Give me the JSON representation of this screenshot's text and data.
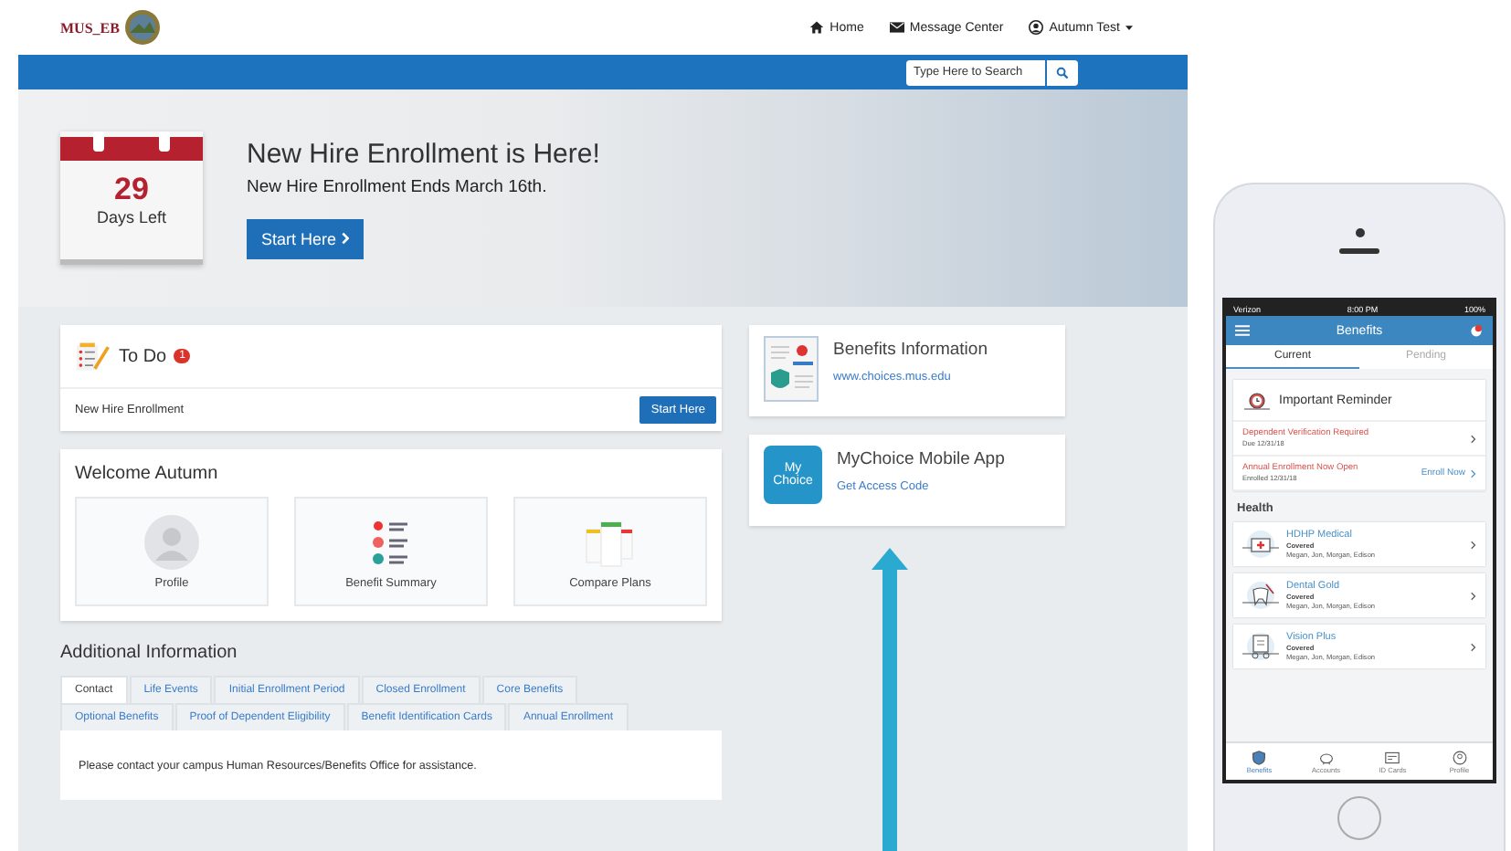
{
  "header": {
    "logo_text": "MUS_EB",
    "nav": [
      {
        "kind": "home",
        "label": "Home"
      },
      {
        "kind": "mail",
        "label": "Message Center"
      },
      {
        "kind": "user",
        "label": "Autumn Test"
      }
    ]
  },
  "search": {
    "placeholder": "Type Here to Search"
  },
  "hero": {
    "days": "29",
    "days_label": "Days Left",
    "title": "New Hire Enrollment is Here!",
    "subtitle": "New Hire Enrollment Ends March 16th.",
    "button": "Start Here"
  },
  "todo": {
    "title": "To Do",
    "count": "1",
    "item": "New Hire Enrollment",
    "button": "Start Here"
  },
  "welcome": {
    "title": "Welcome Autumn",
    "tiles": [
      {
        "kind": "profile",
        "label": "Profile"
      },
      {
        "kind": "summary",
        "label": "Benefit Summary"
      },
      {
        "kind": "compare",
        "label": "Compare Plans"
      }
    ]
  },
  "additional": {
    "title": "Additional Information",
    "tab_rows": [
      [
        {
          "label": "Contact",
          "selected": true
        },
        {
          "label": "Life Events",
          "selected": false
        },
        {
          "label": "Initial Enrollment Period",
          "selected": false
        },
        {
          "label": "Closed Enrollment",
          "selected": false
        },
        {
          "label": "Core Benefits",
          "selected": false
        }
      ],
      [
        {
          "label": "Optional Benefits",
          "selected": false
        },
        {
          "label": "Proof of Dependent Eligibility",
          "selected": false
        },
        {
          "label": "Benefit Identification Cards",
          "selected": false
        },
        {
          "label": "Annual Enrollment",
          "selected": false
        }
      ]
    ],
    "content": "Please contact your campus Human Resources/Benefits Office for assistance."
  },
  "benefits_info": {
    "title": "Benefits Information",
    "link": "www.choices.mus.edu"
  },
  "mobile_app": {
    "icon_lines": [
      "My",
      "Choice"
    ],
    "title": "MyChoice Mobile App",
    "link": "Get Access Code"
  },
  "phone": {
    "status": {
      "carrier": "Verizon",
      "time": "8:00 PM",
      "battery": "100%"
    },
    "title": "Benefits",
    "tabs": [
      {
        "label": "Current",
        "selected": true
      },
      {
        "label": "Pending",
        "selected": false
      }
    ],
    "reminder": {
      "title": "Important Reminder",
      "items": [
        {
          "title": "Dependent Verification Required",
          "detail": "Due 12/31/18"
        },
        {
          "title": "Annual Enrollment Now Open",
          "detail": "Enrolled 12/31/18",
          "action": "Enroll Now"
        }
      ]
    },
    "section": "Health",
    "plans": [
      {
        "kind": "medical",
        "name": "HDHP Medical",
        "status": "Covered",
        "members": "Megan, Jon, Morgan, Edison"
      },
      {
        "kind": "dental",
        "name": "Dental Gold",
        "status": "Covered",
        "members": "Megan, Jon, Morgan, Edison"
      },
      {
        "kind": "vision",
        "name": "Vision Plus",
        "status": "Covered",
        "members": "Megan, Jon, Morgan, Edison"
      }
    ],
    "nav": [
      {
        "kind": "shield",
        "label": "Benefits",
        "selected": true
      },
      {
        "kind": "piggy",
        "label": "Accounts",
        "selected": false
      },
      {
        "kind": "card",
        "label": "ID Cards",
        "selected": false
      },
      {
        "kind": "user",
        "label": "Profile",
        "selected": false
      }
    ]
  }
}
